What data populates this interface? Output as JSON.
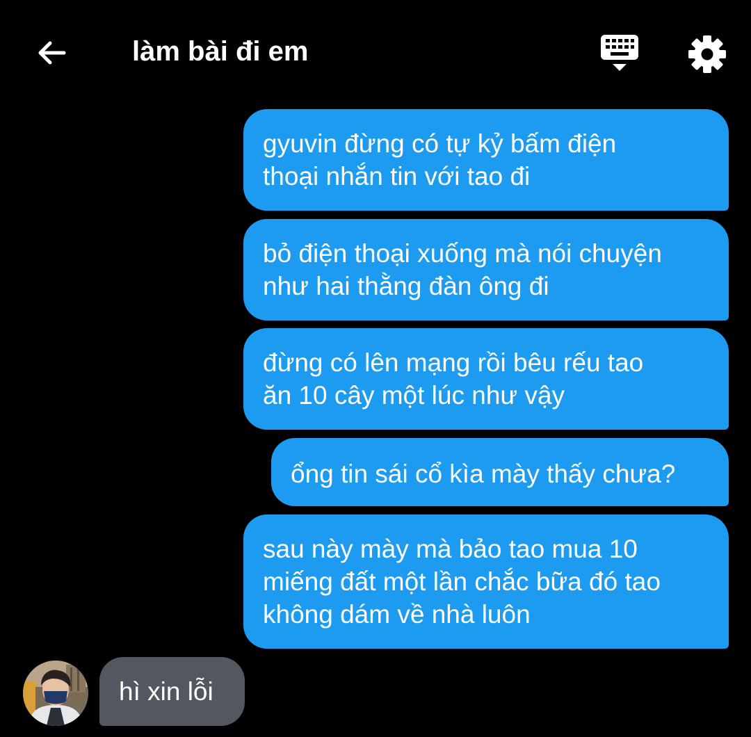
{
  "header": {
    "back_icon": "arrow-left-icon",
    "title": "làm bài đi em",
    "keyboard_icon": "keyboard-hide-icon",
    "settings_icon": "gear-icon"
  },
  "messages": [
    {
      "direction": "outgoing",
      "text": "gyuvin đừng có tự kỷ bấm điện\nthoại nhắn tin với tao đi"
    },
    {
      "direction": "outgoing",
      "text": "bỏ điện thoại xuống mà nói chuyện\nnhư hai thằng đàn ông đi"
    },
    {
      "direction": "outgoing",
      "text": "đừng có lên mạng rồi bêu rếu tao\năn 10 cây một lúc như vậy"
    },
    {
      "direction": "outgoing",
      "text": "ổng tin sái cổ kìa mày thấy chưa?"
    },
    {
      "direction": "outgoing",
      "text": "sau này mày mà bảo tao mua 10\nmiếng đất một lần chắc bữa đó tao\nkhông dám về nhà luôn"
    },
    {
      "direction": "incoming",
      "text": "hì xin lỗi"
    }
  ],
  "colors": {
    "background": "#000000",
    "outgoing_bubble": "#1d9bf0",
    "incoming_bubble": "#535860",
    "text": "#ffffff"
  }
}
